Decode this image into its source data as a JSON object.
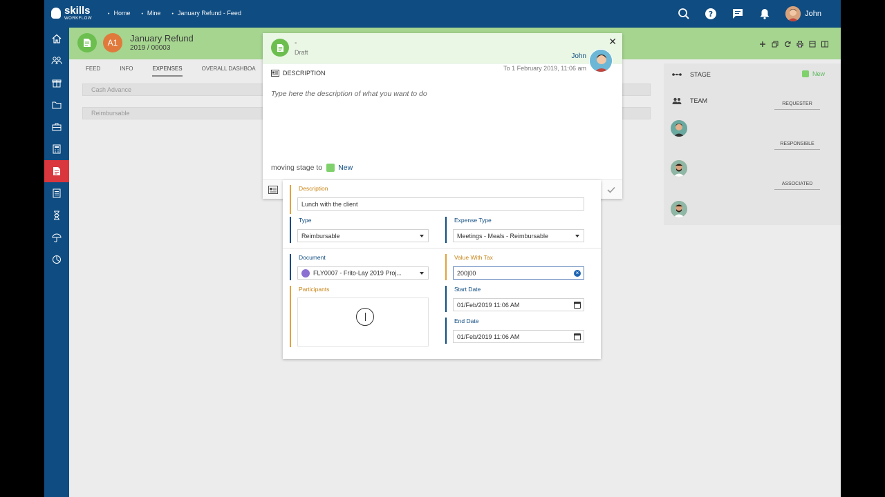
{
  "app": {
    "logo_main": "skills",
    "logo_sub": "WORKFLOW",
    "breadcrumbs": [
      "Home",
      "Mine",
      "January Refund - Feed"
    ],
    "user_name": "John"
  },
  "document": {
    "badge": "A1",
    "title": "January Refund",
    "number": "2019 / 00003",
    "tabs": [
      {
        "label": "FEED",
        "active": false
      },
      {
        "label": "INFO",
        "active": false
      },
      {
        "label": "EXPENSES",
        "active": true
      },
      {
        "label": "OVERALL DASHBOA",
        "active": false
      }
    ],
    "field_bars": [
      "Cash Advance",
      "Reimbursable"
    ]
  },
  "right_panel": {
    "stage_label": "STAGE",
    "stage_value": "New",
    "team_label": "TEAM",
    "roles": [
      "REQUESTER",
      "RESPONSIBLE",
      "ASSOCIATED"
    ]
  },
  "modal": {
    "dash": "-",
    "status": "Draft",
    "user": "John",
    "description_label": "DESCRIPTION",
    "date": "To 1 February 2019, 11:06 am",
    "placeholder": "Type here the description of what you want to do",
    "moving_text": "moving stage to",
    "moving_stage": "New"
  },
  "form": {
    "description_label": "Description",
    "description_value": "Lunch with the client",
    "type_label": "Type",
    "type_value": "Reimbursable",
    "expense_type_label": "Expense Type",
    "expense_type_value": "Meetings - Meals - Reimbursable",
    "document_label": "Document",
    "document_value": "FLY0007 - Frito-Lay 2019 Proj...",
    "value_label": "Value With Tax",
    "value_value": "200|00",
    "participants_label": "Participants",
    "start_label": "Start Date",
    "start_value": "01/Feb/2019 11:06 AM",
    "end_label": "End Date",
    "end_value": "01/Feb/2019 11:06 AM"
  },
  "colors": {
    "primary": "#0f4c81",
    "header_green": "#a5d58f",
    "active_red": "#d9363e",
    "stage_green": "#7fd16b",
    "label_orange": "#c88416"
  },
  "icons": {
    "top": [
      "search-icon",
      "help-icon",
      "chat-icon",
      "bell-icon"
    ],
    "sidebar": [
      "home-icon",
      "users-icon",
      "gift-icon",
      "folder-icon",
      "briefcase-icon",
      "calculator-icon",
      "document-icon",
      "list-icon",
      "hourglass-icon",
      "umbrella-icon",
      "chart-icon"
    ]
  }
}
